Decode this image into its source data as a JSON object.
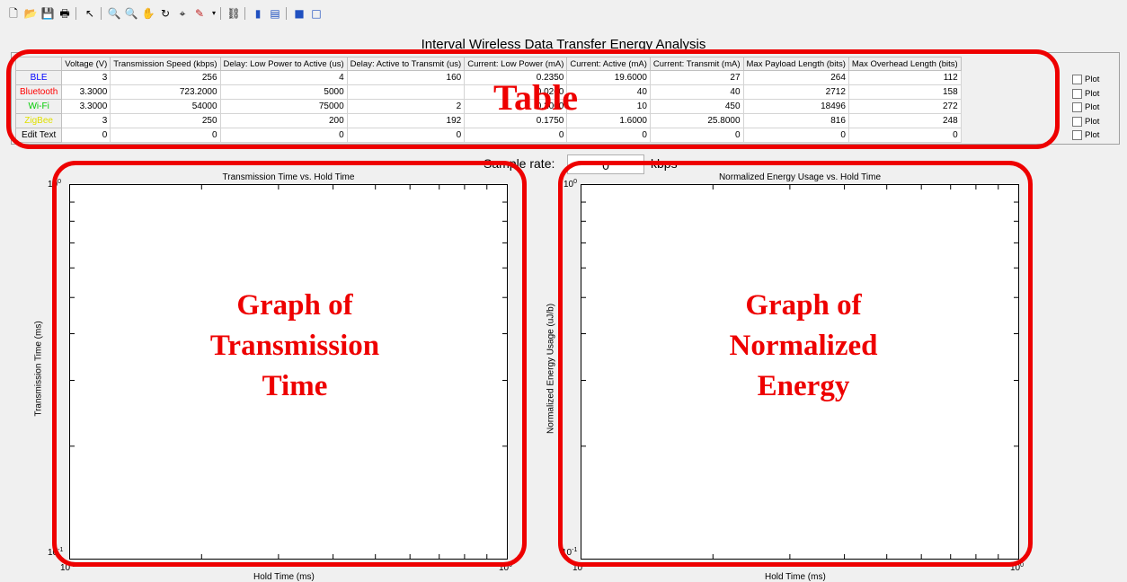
{
  "toolbar": {
    "icons": [
      "new-figure-icon",
      "open-file-icon",
      "save-icon",
      "print-icon",
      "pointer-icon",
      "zoom-in-icon",
      "zoom-out-icon",
      "pan-icon",
      "rotate-3d-icon",
      "data-cursor-icon",
      "brush-icon",
      "link-plot-icon",
      "colorbar-icon",
      "legend-icon",
      "hide-plot-tools-icon",
      "show-plot-tools-icon"
    ]
  },
  "figure": {
    "title": "Interval Wireless Data Transfer Energy Analysis"
  },
  "table": {
    "columns": [
      "Voltage (V)",
      "Transmission Speed (kbps)",
      "Delay: Low Power to Active (us)",
      "Delay: Active to Transmit (us)",
      "Current: Low Power (mA)",
      "Current: Active (mA)",
      "Current: Transmit (mA)",
      "Max Payload Length (bits)",
      "Max Overhead Length (bits)"
    ],
    "rows": [
      {
        "label": "BLE",
        "color": "#0000ff",
        "cells": [
          "3",
          "256",
          "4",
          "160",
          "0.2350",
          "19.6000",
          "27",
          "264",
          "112"
        ]
      },
      {
        "label": "Bluetooth",
        "color": "#ff0000",
        "cells": [
          "3.3000",
          "723.2000",
          "5000",
          "",
          "0.0260",
          "40",
          "40",
          "2712",
          "158"
        ]
      },
      {
        "label": "Wi-Fi",
        "color": "#00cc00",
        "cells": [
          "3.3000",
          "54000",
          "75000",
          "2",
          "0.2000",
          "10",
          "450",
          "18496",
          "272"
        ]
      },
      {
        "label": "ZigBee",
        "color": "#e0e000",
        "cells": [
          "3",
          "250",
          "200",
          "192",
          "0.1750",
          "1.6000",
          "25.8000",
          "816",
          "248"
        ]
      },
      {
        "label": "Edit Text",
        "color": "#000000",
        "cells": [
          "0",
          "0",
          "0",
          "0",
          "0",
          "0",
          "0",
          "0",
          "0"
        ]
      }
    ],
    "plot_label": "Plot"
  },
  "sample": {
    "label": "Sample rate:",
    "value": "0",
    "unit": "kbps"
  },
  "chart_data": [
    {
      "type": "line",
      "title": "Transmission Time vs. Hold Time",
      "xlabel": "Hold Time (ms)",
      "ylabel": "Transmission Time (ms)",
      "xscale": "log",
      "yscale": "log",
      "xlim": [
        0.1,
        1
      ],
      "ylim": [
        0.1,
        1
      ],
      "xticks": [
        "10",
        "-1",
        "10",
        "0"
      ],
      "series": []
    },
    {
      "type": "line",
      "title": "Normalized Energy Usage vs. Hold Time",
      "xlabel": "Hold Time (ms)",
      "ylabel": "Normalized Energy Usage (uJ/b)",
      "xscale": "log",
      "yscale": "log",
      "xlim": [
        0.1,
        1
      ],
      "ylim": [
        0.1,
        1
      ],
      "series": []
    }
  ],
  "ticks": {
    "base": "10",
    "exp_low": "-1",
    "exp_high": "0"
  },
  "annotations": {
    "table": "Table",
    "graph1": [
      "Graph of",
      "Transmission",
      "Time"
    ],
    "graph2": [
      "Graph of",
      "Normalized",
      "Energy"
    ],
    "color": "#ee0000"
  }
}
